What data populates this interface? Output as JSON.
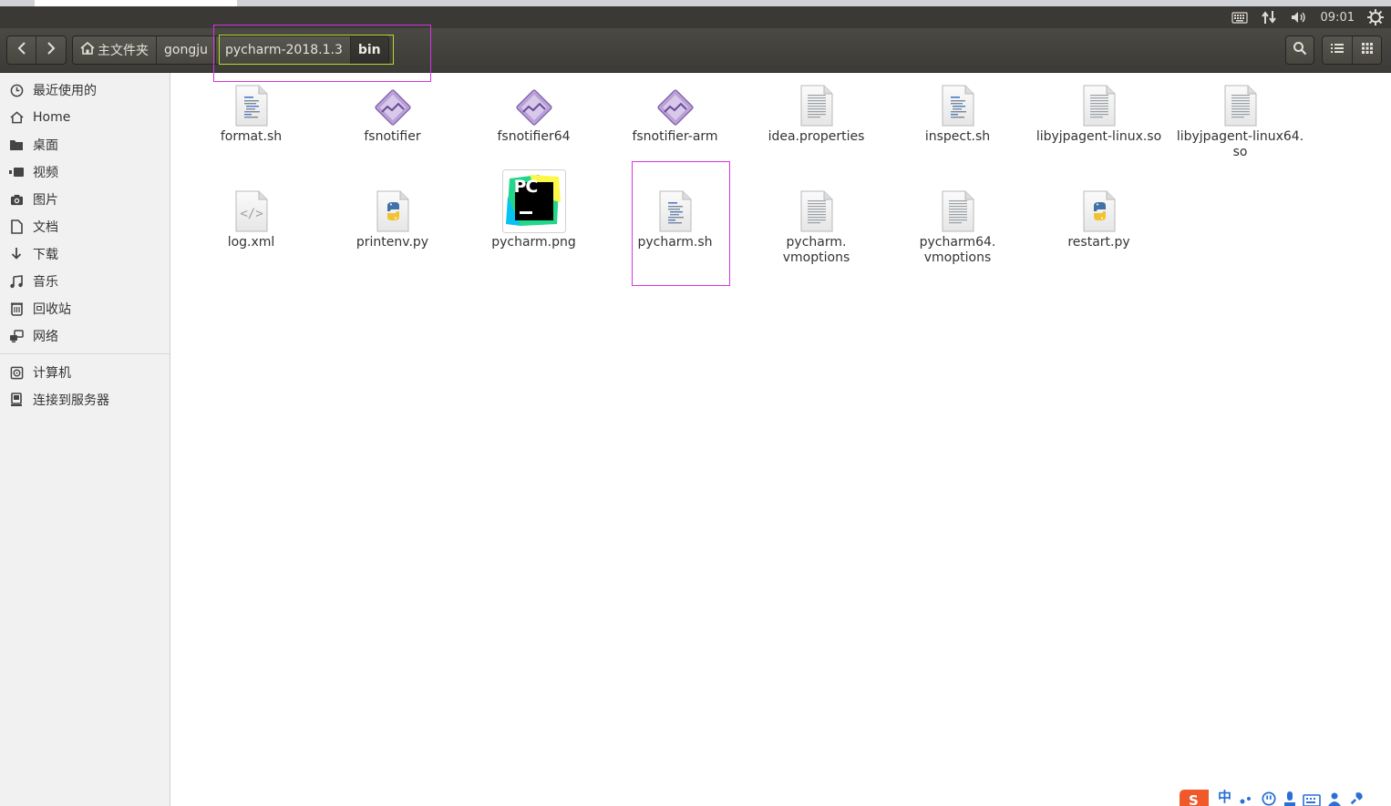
{
  "panel": {
    "clock": "09:01",
    "tray_icons": [
      "keyboard-icon",
      "network-arrows-icon",
      "volume-icon",
      "power-gear-icon"
    ]
  },
  "toolbar": {
    "back": "back-icon",
    "forward": "forward-icon",
    "breadcrumbs": [
      "主文件夹",
      "gongju",
      "pycharm-2018.1.3",
      "bin"
    ],
    "search": "search-icon",
    "list_view": "list-view-icon",
    "grid_view": "grid-view-icon"
  },
  "sidebar": {
    "places": [
      {
        "label": "最近使用的",
        "icon": "clock-icon"
      },
      {
        "label": "Home",
        "icon": "home-icon"
      },
      {
        "label": "桌面",
        "icon": "folder-icon"
      },
      {
        "label": "视频",
        "icon": "video-icon"
      },
      {
        "label": "图片",
        "icon": "camera-icon"
      },
      {
        "label": "文档",
        "icon": "document-icon"
      },
      {
        "label": "下载",
        "icon": "download-icon"
      },
      {
        "label": "音乐",
        "icon": "music-icon"
      },
      {
        "label": "回收站",
        "icon": "trash-icon"
      },
      {
        "label": "网络",
        "icon": "network-icon"
      }
    ],
    "devices": [
      {
        "label": "计算机",
        "icon": "computer-icon"
      },
      {
        "label": "连接到服务器",
        "icon": "server-icon"
      }
    ]
  },
  "files": [
    {
      "name": "format.sh",
      "type": "script"
    },
    {
      "name": "fsnotifier",
      "type": "binary"
    },
    {
      "name": "fsnotifier64",
      "type": "binary"
    },
    {
      "name": "fsnotifier-arm",
      "type": "binary"
    },
    {
      "name": "idea.properties",
      "type": "text"
    },
    {
      "name": "inspect.sh",
      "type": "script"
    },
    {
      "name": "libyjpagent-linux.so",
      "type": "text"
    },
    {
      "name": "libyjpagent-linux64.\nso",
      "type": "text"
    },
    {
      "name": "log.xml",
      "type": "xml"
    },
    {
      "name": "printenv.py",
      "type": "python"
    },
    {
      "name": "pycharm.png",
      "type": "image"
    },
    {
      "name": "pycharm.sh",
      "type": "script"
    },
    {
      "name": "pycharm.\nvmoptions",
      "type": "text"
    },
    {
      "name": "pycharm64.\nvmoptions",
      "type": "text"
    },
    {
      "name": "restart.py",
      "type": "python"
    }
  ],
  "image_text": {
    "pycharm_logo": "PC"
  },
  "ime_icons": [
    "sogou-icon",
    "chinese-mode-icon",
    "punctuation-icon",
    "emoji-icon",
    "mic-icon",
    "soft-keyboard-icon",
    "user-icon",
    "settings-icon"
  ],
  "ime": {
    "mode": "中"
  },
  "colors": {
    "annotation_magenta": "#d733e0",
    "annotation_yellow": "#b8d92a",
    "panel": "#3a3936"
  }
}
